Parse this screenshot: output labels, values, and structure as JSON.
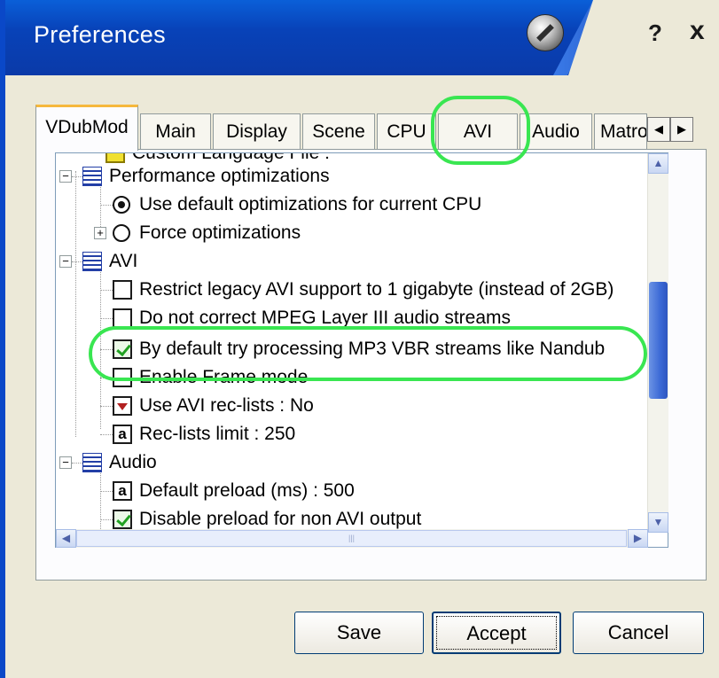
{
  "window": {
    "title": "Preferences",
    "help_label": "?",
    "close_label": "x",
    "accent_color": "#0a48c8"
  },
  "tabs": [
    {
      "label": "VDubMod",
      "active": true
    },
    {
      "label": "Main"
    },
    {
      "label": "Display"
    },
    {
      "label": "Scene"
    },
    {
      "label": "CPU"
    },
    {
      "label": "AVI"
    },
    {
      "label": "Audio"
    },
    {
      "label": "Matro"
    }
  ],
  "tab_scroll": {
    "left": "◀",
    "right": "▶"
  },
  "tree": {
    "items": [
      {
        "label": "Custom Language File :",
        "icon": "folder-icon"
      },
      {
        "label": "Performance optimizations",
        "icon": "doc-icon",
        "expanded": true
      },
      {
        "label": "Use default optimizations for current CPU",
        "icon": "radio-icon",
        "selected": true
      },
      {
        "label": "Force optimizations",
        "icon": "radio-icon",
        "selected": false
      },
      {
        "label": "AVI",
        "icon": "doc-icon",
        "expanded": true
      },
      {
        "label": "Restrict legacy AVI support to 1 gigabyte (instead of 2GB)",
        "icon": "checkbox-icon",
        "checked": false
      },
      {
        "label": "Do not correct MPEG Layer III audio streams",
        "icon": "checkbox-icon",
        "checked": false
      },
      {
        "label": "By default try processing MP3 VBR streams like Nandub",
        "icon": "checkbox-icon",
        "checked": true
      },
      {
        "label": "Enable Frame mode",
        "icon": "checkbox-icon",
        "checked": false
      },
      {
        "label": "Use AVI rec-lists : No",
        "icon": "dropdown-icon"
      },
      {
        "label": "Rec-lists limit : 250",
        "icon": "text-value-icon",
        "glyph": "a"
      },
      {
        "label": "Audio",
        "icon": "doc-icon",
        "expanded": true
      },
      {
        "label": "Default preload (ms) : 500",
        "icon": "text-value-icon",
        "glyph": "a"
      },
      {
        "label": "Disable preload for non AVI output",
        "icon": "checkbox-icon",
        "checked": true
      }
    ]
  },
  "expander": {
    "minus": "−",
    "plus": "+"
  },
  "scroll_glyphs": {
    "up": "▲",
    "down": "▼",
    "left": "◀",
    "right": "▶",
    "grip": "|||"
  },
  "buttons": {
    "save": "Save",
    "accept": "Accept",
    "cancel": "Cancel"
  },
  "highlight_color": "#39e651"
}
